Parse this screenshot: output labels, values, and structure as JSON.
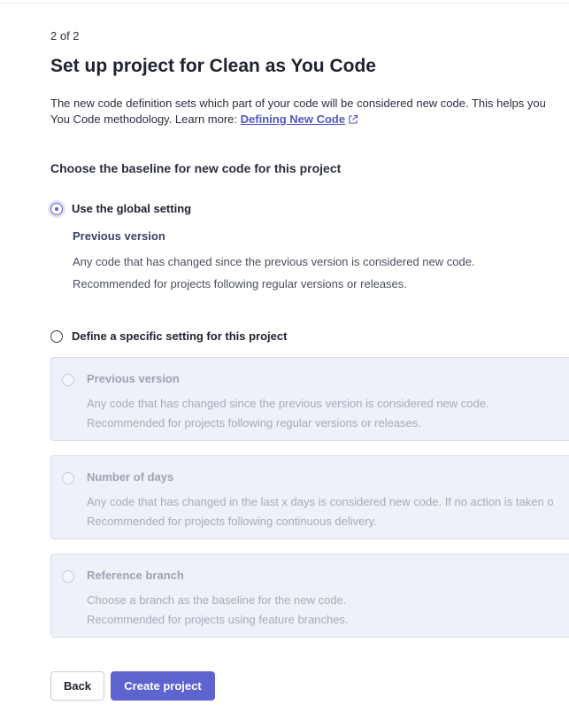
{
  "step": "2 of 2",
  "title": "Set up project for Clean as You Code",
  "intro": {
    "line1": "The new code definition sets which part of your code will be considered new code. This helps you",
    "line2_prefix": "You Code methodology. Learn more: ",
    "link_label": "Defining New Code",
    "link_icon": "external-link-icon"
  },
  "section_label": "Choose the baseline for new code for this project",
  "global_option": {
    "label": "Use the global setting",
    "selected": true,
    "detail_name": "Previous version",
    "detail_line1": "Any code that has changed since the previous version is considered new code.",
    "detail_line2": "Recommended for projects following regular versions or releases."
  },
  "specific_option": {
    "label": "Define a specific setting for this project",
    "selected": false
  },
  "options": [
    {
      "name": "Previous version",
      "line1": "Any code that has changed since the previous version is considered new code.",
      "line2": "Recommended for projects following regular versions or releases."
    },
    {
      "name": "Number of days",
      "line1": "Any code that has changed in the last x days is considered new code. If no action is taken o",
      "line2": "Recommended for projects following continuous delivery."
    },
    {
      "name": "Reference branch",
      "line1": "Choose a branch as the baseline for the new code.",
      "line2": "Recommended for projects using feature branches."
    }
  ],
  "buttons": {
    "back": "Back",
    "create": "Create project"
  },
  "colors": {
    "accent": "#5d63cf",
    "link": "#5157c2",
    "card_bg": "#eef1f8"
  }
}
